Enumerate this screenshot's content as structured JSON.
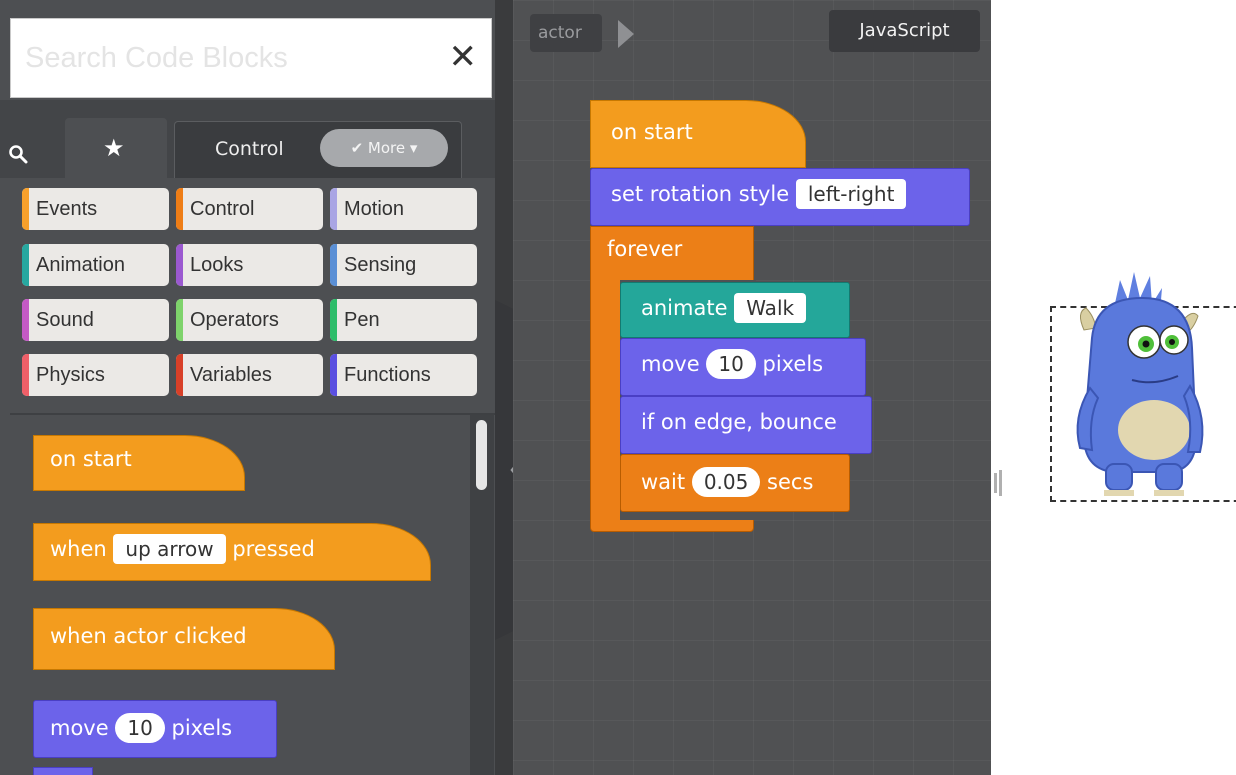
{
  "search": {
    "placeholder": "Search Code Blocks",
    "clear_icon": "close-icon"
  },
  "tabs": {
    "search_icon": "search-icon",
    "favorites_icon": "star-icon",
    "control_label": "Control",
    "more_label": "More ▾"
  },
  "categories": [
    {
      "label": "Events",
      "color": "#f7a02c"
    },
    {
      "label": "Control",
      "color": "#ee7d16"
    },
    {
      "label": "Motion",
      "color": "#a9a5e4"
    },
    {
      "label": "Animation",
      "color": "#27a8a0"
    },
    {
      "label": "Looks",
      "color": "#9b59d0"
    },
    {
      "label": "Sensing",
      "color": "#5a8fd5"
    },
    {
      "label": "Sound",
      "color": "#c45ac5"
    },
    {
      "label": "Operators",
      "color": "#7ed36b"
    },
    {
      "label": "Pen",
      "color": "#2dbd6a"
    },
    {
      "label": "Physics",
      "color": "#ef5f68"
    },
    {
      "label": "Variables",
      "color": "#d84028"
    },
    {
      "label": "Functions",
      "color": "#5a4fe0"
    }
  ],
  "palette_blocks": {
    "on_start": "on start",
    "when_pressed_prefix": "when",
    "when_pressed_key": "up arrow",
    "when_pressed_suffix": "pressed",
    "when_clicked": "when actor clicked",
    "move_prefix": "move",
    "move_value": "10",
    "move_suffix": "pixels"
  },
  "workspace": {
    "actor_label": "actor",
    "language_button": "JavaScript",
    "script": {
      "on_start": "on start",
      "rotation_prefix": "set rotation style",
      "rotation_value": "left-right",
      "forever": "forever",
      "animate_prefix": "animate",
      "animate_value": "Walk",
      "move_prefix": "move",
      "move_value": "10",
      "move_suffix": "pixels",
      "bounce": "if on edge, bounce",
      "wait_prefix": "wait",
      "wait_value": "0.05",
      "wait_suffix": "secs"
    }
  },
  "stage": {
    "actor_icon": "blue-monster-sprite"
  }
}
